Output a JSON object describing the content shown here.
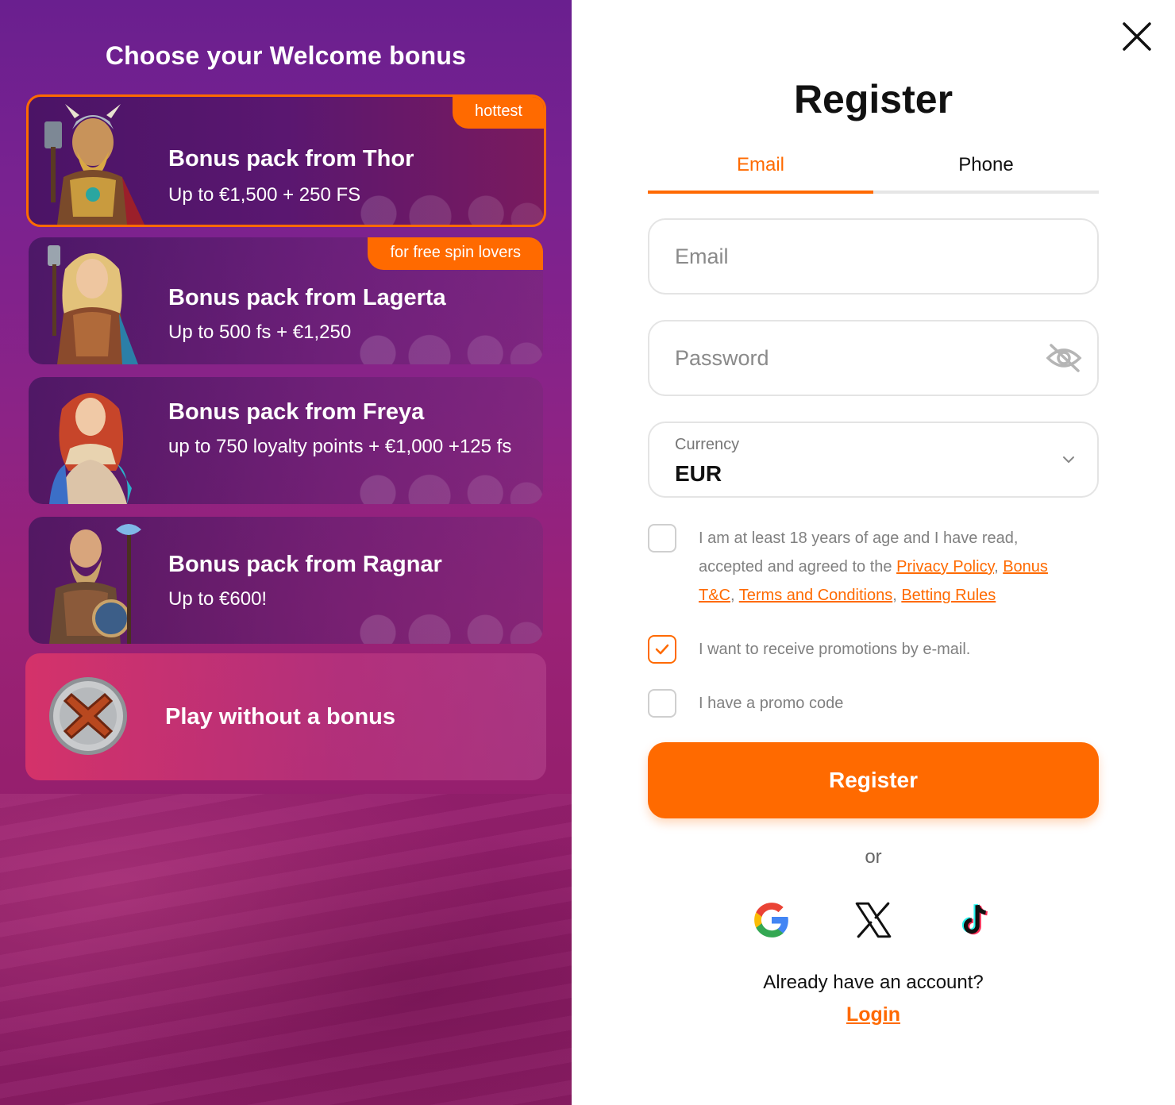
{
  "left": {
    "title": "Choose your Welcome bonus",
    "cards": [
      {
        "title": "Bonus pack from Thor",
        "subtitle": "Up to €1,500 + 250 FS",
        "badge": "hottest",
        "selected": true
      },
      {
        "title": "Bonus pack from Lagerta",
        "subtitle": "Up to 500 fs + €1,250",
        "badge": "for free spin lovers",
        "selected": false
      },
      {
        "title": "Bonus pack from Freya",
        "subtitle": "up to 750 loyalty points + €1,000 +125 fs",
        "badge": "",
        "selected": false
      },
      {
        "title": "Bonus pack from Ragnar",
        "subtitle": "Up to €600!",
        "badge": "",
        "selected": false
      }
    ],
    "no_bonus_label": "Play without a bonus"
  },
  "right": {
    "title": "Register",
    "tabs": [
      {
        "label": "Email",
        "active": true
      },
      {
        "label": "Phone",
        "active": false
      }
    ],
    "email": {
      "placeholder": "Email",
      "value": ""
    },
    "password": {
      "placeholder": "Password",
      "value": ""
    },
    "currency": {
      "label": "Currency",
      "value": "EUR"
    },
    "consent": {
      "text_before": "I am at least 18 years of age and I have read, accepted and agreed to the ",
      "link1": "Privacy Policy",
      "sep1": ", ",
      "link2": "Bonus T&C",
      "sep2": ", ",
      "link3": "Terms and Conditions",
      "sep3": ", ",
      "link4": "Betting Rules",
      "checked": false
    },
    "promotions": {
      "text": "I want to receive promotions by e-mail.",
      "checked": true
    },
    "promo_code": {
      "text": "I have a promo code",
      "checked": false
    },
    "register_button": "Register",
    "or": "or",
    "social": [
      "google-icon",
      "x-icon",
      "tiktok-icon"
    ],
    "already": "Already have an account?",
    "login": "Login"
  },
  "colors": {
    "accent": "#ff6a00",
    "text": "#111111",
    "muted": "#808080"
  }
}
